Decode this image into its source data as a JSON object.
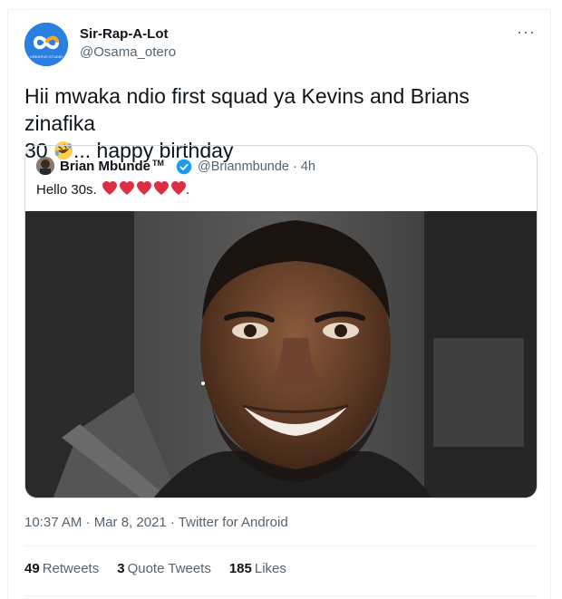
{
  "author": {
    "display_name": "Sir-Rap-A-Lot",
    "handle": "@Osama_otero",
    "avatar_icon": "infinity-logo-icon",
    "avatar_caption": "CREATIVE STUDIO"
  },
  "menu_icon": "more-options-icon",
  "tweet": {
    "text_line1": "Hii mwaka ndio first squad ya Kevins and Brians zinafika",
    "text_line2_prefix": "30 ",
    "emoji": "rolling-on-floor-laughing-emoji",
    "text_line2_suffix": "... happy birthday"
  },
  "quoted": {
    "display_name": "Brian Mbunde",
    "tm": "TM",
    "verified_icon": "verified-badge-icon",
    "handle_time": "@Brianmbunde · 4h",
    "text": "Hello 30s.",
    "hearts_count": 5,
    "text_suffix": ".",
    "photo_icon": "selfie-photo"
  },
  "meta": {
    "timestamp": "10:37 AM · Mar 8, 2021 · Twitter for Android"
  },
  "stats": {
    "retweets_count": "49",
    "retweets_label": "Retweets",
    "quotes_count": "3",
    "quotes_label": "Quote Tweets",
    "likes_count": "185",
    "likes_label": "Likes"
  },
  "colors": {
    "text": "#0f1419",
    "muted": "#536471",
    "verified": "#1d9bf0",
    "heart": "#dd2e44",
    "brand": "#1a6ed8"
  }
}
